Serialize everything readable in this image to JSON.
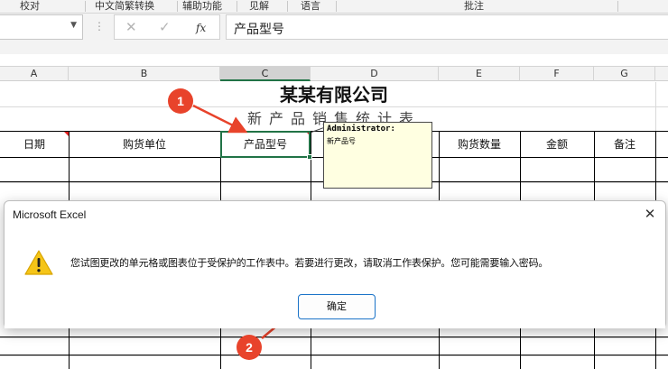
{
  "ribbon": {
    "groups": [
      "校对",
      "中文简繁转换",
      "辅助功能",
      "见解",
      "语言",
      "批注"
    ]
  },
  "formula_bar": {
    "name_box_value": "",
    "fx_label": "fx",
    "content": "产品型号"
  },
  "columns": [
    "A",
    "B",
    "C",
    "D",
    "E",
    "F",
    "G"
  ],
  "sheet": {
    "title": "某某有限公司",
    "subtitle": "新产品销售统计表",
    "headers": [
      "日期",
      "购货单位",
      "产品型号",
      "",
      "购货数量",
      "金额",
      "备注"
    ]
  },
  "comment": {
    "author": "Administrator:",
    "text": "新产品号"
  },
  "markers": {
    "first": "1",
    "second": "2"
  },
  "dialog": {
    "title": "Microsoft Excel",
    "message": "您试图更改的单元格或图表位于受保护的工作表中。若要进行更改，请取消工作表保护。您可能需要输入密码。",
    "ok_label": "确定",
    "close_glyph": "✕"
  },
  "colors": {
    "accent_green": "#217346",
    "marker_red": "#e8432b",
    "comment_bg": "#ffffe1",
    "dialog_button_border": "#1a73c8"
  }
}
